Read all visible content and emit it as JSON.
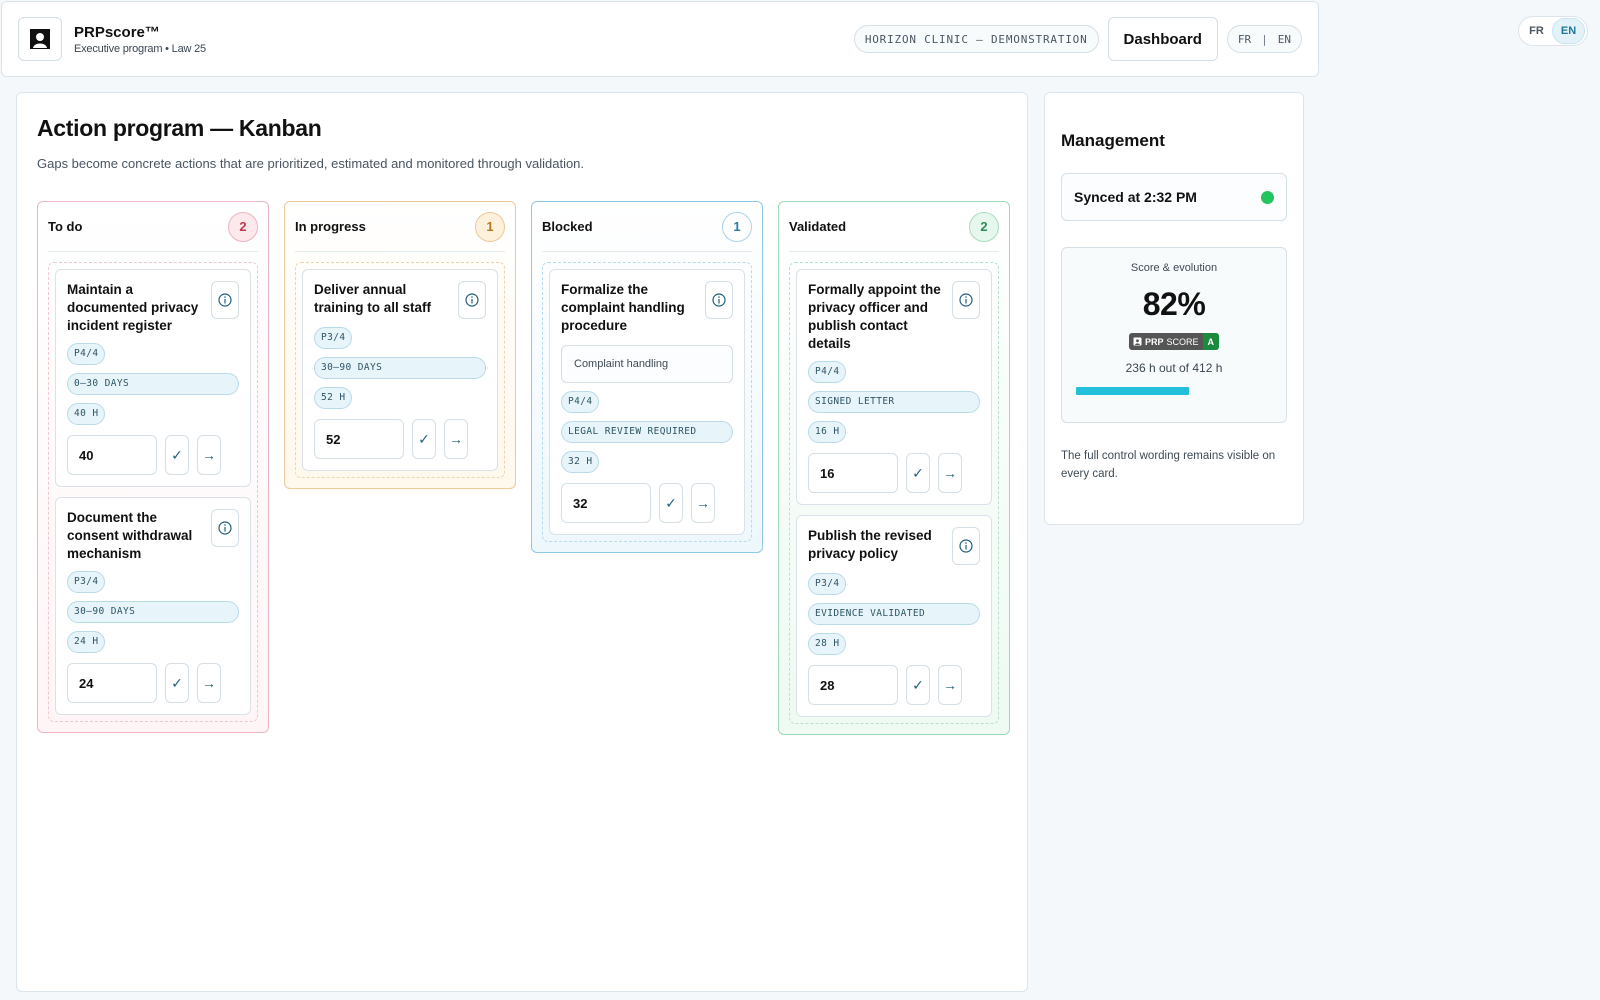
{
  "header": {
    "brand_name": "PRPscore™",
    "brand_sub": "Executive program • Law 25",
    "clinic": "HORIZON CLINIC — DEMONSTRATION",
    "dashboard_label": "Dashboard",
    "lang_fr": "FR",
    "lang_sep": "|",
    "lang_en": "EN"
  },
  "float_lang": {
    "fr": "FR",
    "en": "EN",
    "active": "EN"
  },
  "main": {
    "title": "Action program — Kanban",
    "subtitle": "Gaps become concrete actions that are prioritized, estimated and monitored through validation."
  },
  "columns": [
    {
      "title": "To do",
      "count": "2",
      "cards": [
        {
          "title": "Maintain a documented privacy incident register",
          "priority": "P4/4",
          "timeline": "0–30 DAYS",
          "estimate": "40 H",
          "hours": "40"
        },
        {
          "title": "Document the consent withdrawal mechanism",
          "priority": "P3/4",
          "timeline": "30–90 DAYS",
          "estimate": "24 H",
          "hours": "24"
        }
      ]
    },
    {
      "title": "In progress",
      "count": "1",
      "cards": [
        {
          "title": "Deliver annual training to all staff",
          "priority": "P3/4",
          "timeline": "30–90 DAYS",
          "estimate": "52 H",
          "hours": "52"
        }
      ]
    },
    {
      "title": "Blocked",
      "count": "1",
      "cards": [
        {
          "title": "Formalize the complaint handling procedure",
          "subfield": "Complaint handling",
          "priority": "P4/4",
          "timeline": "LEGAL REVIEW REQUIRED",
          "estimate": "32 H",
          "hours": "32"
        }
      ]
    },
    {
      "title": "Validated",
      "count": "2",
      "cards": [
        {
          "title": "Formally appoint the privacy officer and publish contact details",
          "priority": "P4/4",
          "timeline": "SIGNED LETTER",
          "estimate": "16 H",
          "hours": "16"
        },
        {
          "title": "Publish the revised privacy policy",
          "priority": "P3/4",
          "timeline": "EVIDENCE VALIDATED",
          "estimate": "28 H",
          "hours": "28"
        }
      ]
    }
  ],
  "management": {
    "title": "Management",
    "sync_text": "Synced at 2:32 PM",
    "score_label": "Score & evolution",
    "score_value": "82%",
    "badge_brand_bold": "PRP",
    "badge_brand_thin": "SCORE",
    "badge_grade": "A",
    "hours_text": "236 h out of 412 h",
    "progress_fraction": 0.573,
    "note": "The full control wording remains visible on every card."
  },
  "colors": {
    "accent": "#22c1d9",
    "sync_ok": "#22c55e",
    "todo": "#c0394f",
    "in_progress": "#b37a1f",
    "blocked": "#2b7aa5",
    "validated": "#2a8d58"
  },
  "icons": {
    "logo": "user-silhouette-icon",
    "info": "info-circle-icon",
    "validate": "check-icon",
    "move": "arrow-right-icon"
  }
}
